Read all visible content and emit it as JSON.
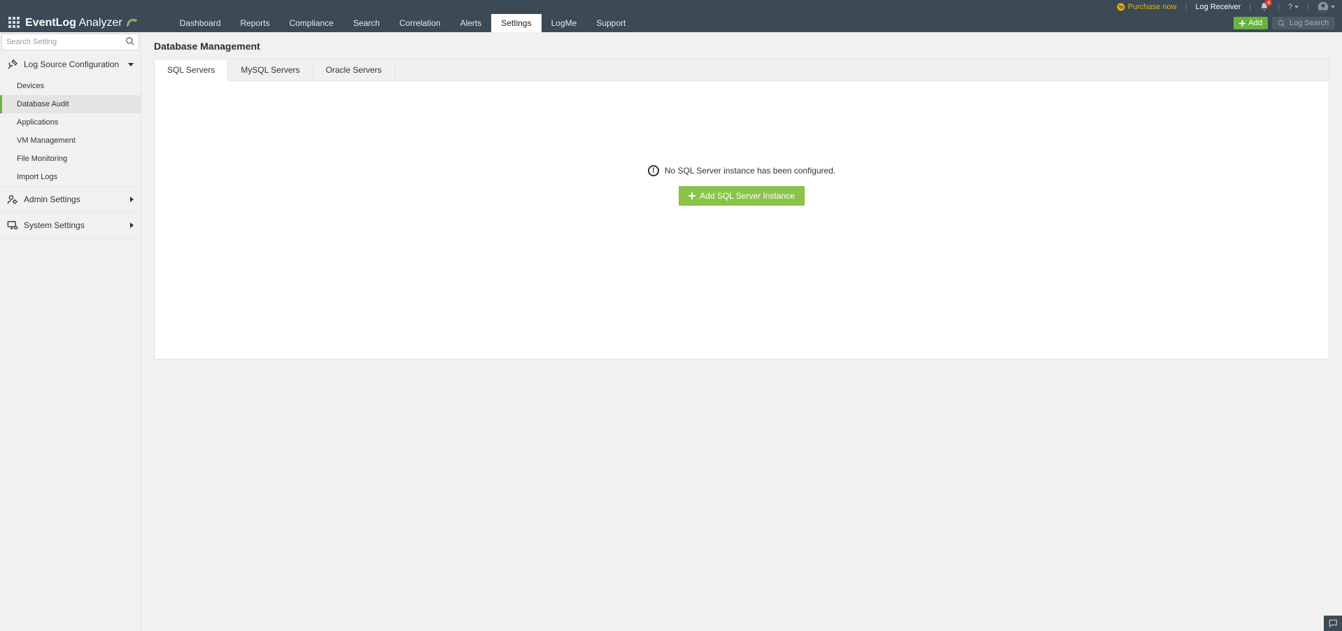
{
  "topbar": {
    "purchase": "Purchase now",
    "log_receiver": "Log Receiver",
    "notif_count": "4",
    "help": "?"
  },
  "nav": {
    "brand_a": "EventLog",
    "brand_b": "Analyzer",
    "tabs": [
      "Dashboard",
      "Reports",
      "Compliance",
      "Search",
      "Correlation",
      "Alerts",
      "Settings",
      "LogMe",
      "Support"
    ],
    "active_tab": "Settings",
    "add": "Add",
    "log_search": "Log Search"
  },
  "sidebar": {
    "search_placeholder": "Search Setting",
    "sections": [
      {
        "title": "Log Source Configuration",
        "expanded": true,
        "items": [
          "Devices",
          "Database Audit",
          "Applications",
          "VM Management",
          "File Monitoring",
          "Import Logs"
        ],
        "active": "Database Audit"
      },
      {
        "title": "Admin Settings",
        "expanded": false
      },
      {
        "title": "System Settings",
        "expanded": false
      }
    ]
  },
  "page": {
    "title": "Database Management",
    "subtabs": [
      "SQL Servers",
      "MySQL Servers",
      "Oracle Servers"
    ],
    "active_subtab": "SQL Servers",
    "empty_msg": "No SQL Server instance has been configured.",
    "add_instance": "Add SQL Server Instance"
  }
}
